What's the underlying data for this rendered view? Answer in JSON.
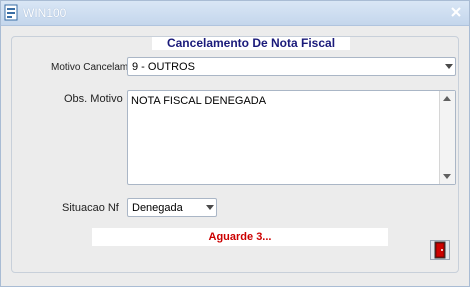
{
  "window": {
    "title": "WIN100"
  },
  "form": {
    "title": "Cancelamento De Nota Fiscal",
    "motivo_label": "Motivo Cancelamento",
    "motivo_value": "9 - OUTROS",
    "obs_label": "Obs. Motivo",
    "obs_value": "NOTA FISCAL DENEGADA",
    "situacao_label": "Situacao Nf",
    "situacao_value": "Denegada",
    "status_message": "Aguarde 3..."
  },
  "colors": {
    "title_text": "#1a1a7a",
    "status_text": "#cc0000",
    "exit_icon": "#cc0000"
  },
  "icons": {
    "app": "window-app-icon",
    "close": "close-icon",
    "exit": "exit-door-icon"
  }
}
